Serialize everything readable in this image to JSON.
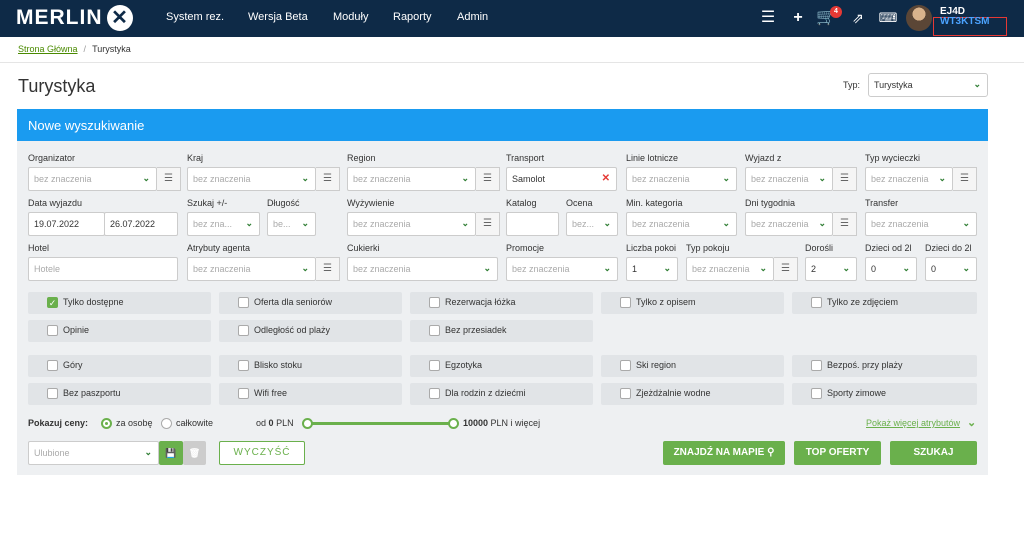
{
  "nav": {
    "logo": "MERLIN",
    "items": [
      "System rez.",
      "Wersja Beta",
      "Moduły",
      "Raporty",
      "Admin"
    ],
    "cart_count": "4",
    "user_name": "EJ4D",
    "user_code": "WT3KTSM"
  },
  "breadcrumb": {
    "home": "Strona Główna",
    "current": "Turystyka"
  },
  "page": {
    "title": "Turystyka",
    "typ_label": "Typ:",
    "typ_value": "Turystyka"
  },
  "panel": {
    "header": "Nowe wyszukiwanie"
  },
  "row1": {
    "labels": [
      "Organizator",
      "Kraj",
      "Region",
      "Transport",
      "Linie lotnicze",
      "Wyjazd z",
      "Typ wycieczki"
    ],
    "organizator": "bez znaczenia",
    "kraj": "bez znaczenia",
    "region": "bez znaczenia",
    "transport": "Samolot",
    "linie": "bez znaczenia",
    "wyjazd": "bez znaczenia",
    "typ_wycieczki": "bez znaczenia"
  },
  "row2": {
    "labels": [
      "Data wyjazdu",
      "Szukaj +/-",
      "Długość",
      "Wyżywienie",
      "Katalog",
      "Ocena",
      "Min. kategoria",
      "Dni tygodnia",
      "Transfer"
    ],
    "date_from": "19.07.2022",
    "date_to": "26.07.2022",
    "szukaj": "bez zna...",
    "dlugosc": "be...",
    "wyzywienie": "bez znaczenia",
    "katalog": "",
    "ocena": "bez...",
    "kategoria": "bez znaczenia",
    "dni": "bez znaczenia",
    "transfer": "bez znaczenia"
  },
  "row3": {
    "labels": [
      "Hotel",
      "Atrybuty agenta",
      "Cukierki",
      "Promocje",
      "Liczba pokoi",
      "Typ pokoju",
      "Dorośli",
      "Dzieci od 2l",
      "Dzieci do 2l"
    ],
    "hotel_placeholder": "Hotele",
    "atrybuty": "bez znaczenia",
    "cukierki": "bez znaczenia",
    "promocje": "bez znaczenia",
    "pokoje": "1",
    "typ_pokoju": "bez znaczenia",
    "dorosli": "2",
    "dzieci_od": "0",
    "dzieci_do": "0"
  },
  "checkboxes_a": [
    {
      "label": "Tylko dostępne",
      "checked": true
    },
    {
      "label": "Oferta dla seniorów",
      "checked": false
    },
    {
      "label": "Rezerwacja łóżka",
      "checked": false
    },
    {
      "label": "Tylko z opisem",
      "checked": false
    },
    {
      "label": "Tylko ze zdjęciem",
      "checked": false
    },
    {
      "label": "Opinie",
      "checked": false
    },
    {
      "label": "Odległość od plaży",
      "checked": false
    },
    {
      "label": "Bez przesiadek",
      "checked": false
    }
  ],
  "checkboxes_b": [
    {
      "label": "Góry",
      "checked": false
    },
    {
      "label": "Blisko stoku",
      "checked": false
    },
    {
      "label": "Egzotyka",
      "checked": false
    },
    {
      "label": "Ski region",
      "checked": false
    },
    {
      "label": "Bezpoś. przy plaży",
      "checked": false
    },
    {
      "label": "Bez paszportu",
      "checked": false
    },
    {
      "label": "Wifi free",
      "checked": false
    },
    {
      "label": "Dla rodzin z dziećmi",
      "checked": false
    },
    {
      "label": "Zjeżdżalnie wodne",
      "checked": false
    },
    {
      "label": "Sporty zimowe",
      "checked": false
    }
  ],
  "prices": {
    "label": "Pokazuj ceny:",
    "per_person": "za osobę",
    "total": "całkowite",
    "from_prefix": "od",
    "from_value": "0",
    "currency": "PLN",
    "to_value": "10000",
    "to_suffix": "PLN i więcej",
    "more_attrs": "Pokaż więcej atrybutów"
  },
  "footer": {
    "favorites": "Ulubione",
    "clear": "WYCZYŚĆ",
    "map": "ZNAJDŹ NA MAPIE",
    "top": "TOP OFERTY",
    "search": "SZUKAJ"
  },
  "colors": {
    "nav": "#0e2a47",
    "accent": "#1a9bf0",
    "green": "#6ab04c"
  }
}
